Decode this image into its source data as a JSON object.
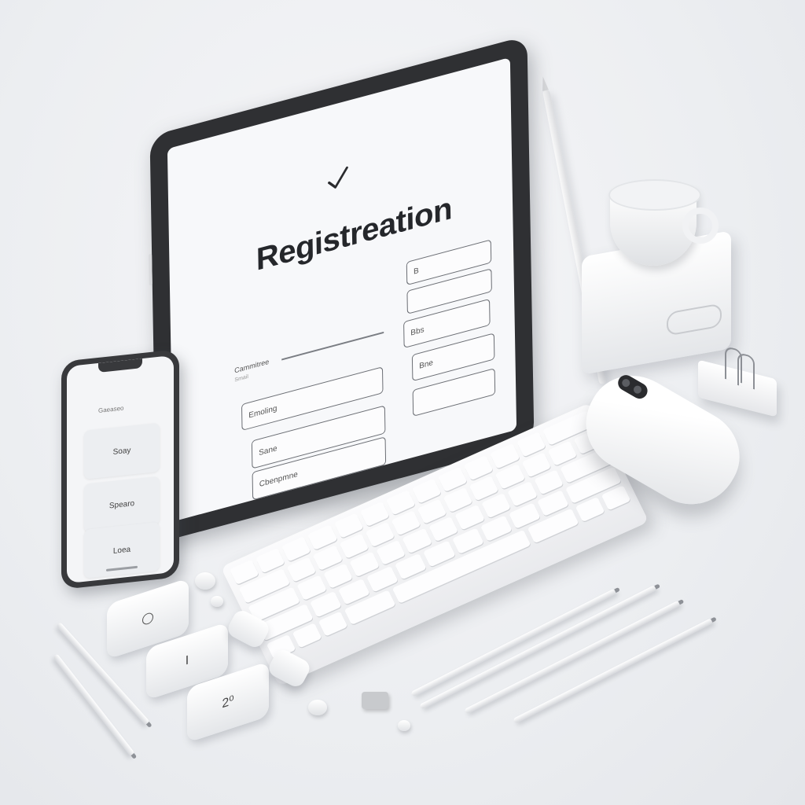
{
  "tablet": {
    "title": "Registreation",
    "check_icon": "check-icon",
    "left_fields": [
      {
        "label": "Cammitree"
      },
      {
        "label": "Emoling"
      },
      {
        "label": "Sane"
      },
      {
        "label": "Cbenpmne"
      }
    ],
    "right_fields": [
      {
        "value": "B"
      },
      {
        "value": "Bbs"
      },
      {
        "value": "Bne"
      },
      {
        "value": ""
      }
    ],
    "sublabel": "Smail"
  },
  "phone": {
    "header": "Gaeaseo",
    "cards": [
      "Soay",
      "Spearo",
      "Loea"
    ]
  },
  "pucks": {
    "a": "I",
    "b": "2⁰"
  },
  "colors": {
    "background": "#eceef1",
    "device_frame": "#2f3033",
    "screen": "#f7f8fa",
    "text": "#25272b"
  }
}
